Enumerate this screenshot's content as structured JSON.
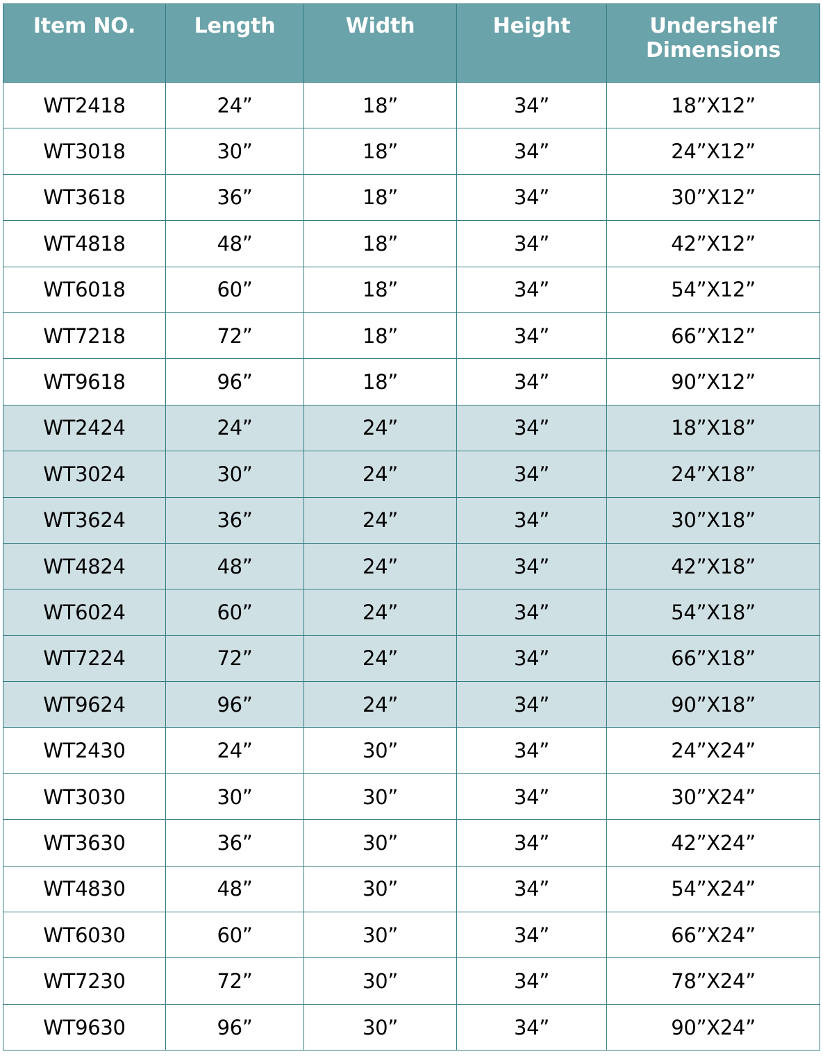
{
  "table": {
    "headers": [
      "Item NO.",
      "Length",
      "Width",
      "Height",
      "Undershelf Dimensions"
    ],
    "colors": {
      "header_background": "#6AA3A9",
      "header_text": "#FFFFFF",
      "border": "#2F7B82",
      "shaded_row_background": "#CFE0E4",
      "plain_row_background": "#FFFFFF",
      "cell_text": "#000000"
    },
    "rows": [
      {
        "item_no": "WT2418",
        "length": "24”",
        "width": "18”",
        "height": "34”",
        "undershelf": "18”X12”",
        "shaded": false
      },
      {
        "item_no": "WT3018",
        "length": "30”",
        "width": "18”",
        "height": "34”",
        "undershelf": "24”X12”",
        "shaded": false
      },
      {
        "item_no": "WT3618",
        "length": "36”",
        "width": "18”",
        "height": "34”",
        "undershelf": "30”X12”",
        "shaded": false
      },
      {
        "item_no": "WT4818",
        "length": "48”",
        "width": "18”",
        "height": "34”",
        "undershelf": "42”X12”",
        "shaded": false
      },
      {
        "item_no": "WT6018",
        "length": "60”",
        "width": "18”",
        "height": "34”",
        "undershelf": "54”X12”",
        "shaded": false
      },
      {
        "item_no": "WT7218",
        "length": "72”",
        "width": "18”",
        "height": "34”",
        "undershelf": "66”X12”",
        "shaded": false
      },
      {
        "item_no": "WT9618",
        "length": "96”",
        "width": "18”",
        "height": "34”",
        "undershelf": "90”X12”",
        "shaded": false
      },
      {
        "item_no": "WT2424",
        "length": "24”",
        "width": "24”",
        "height": "34”",
        "undershelf": "18”X18”",
        "shaded": true
      },
      {
        "item_no": "WT3024",
        "length": "30”",
        "width": "24”",
        "height": "34”",
        "undershelf": "24”X18”",
        "shaded": true
      },
      {
        "item_no": "WT3624",
        "length": "36”",
        "width": "24”",
        "height": "34”",
        "undershelf": "30”X18”",
        "shaded": true
      },
      {
        "item_no": "WT4824",
        "length": "48”",
        "width": "24”",
        "height": "34”",
        "undershelf": "42”X18”",
        "shaded": true
      },
      {
        "item_no": "WT6024",
        "length": "60”",
        "width": "24”",
        "height": "34”",
        "undershelf": "54”X18”",
        "shaded": true
      },
      {
        "item_no": "WT7224",
        "length": "72”",
        "width": "24”",
        "height": "34”",
        "undershelf": "66”X18”",
        "shaded": true
      },
      {
        "item_no": "WT9624",
        "length": "96”",
        "width": "24”",
        "height": "34”",
        "undershelf": "90”X18”",
        "shaded": true
      },
      {
        "item_no": "WT2430",
        "length": "24”",
        "width": "30”",
        "height": "34”",
        "undershelf": "24”X24”",
        "shaded": false
      },
      {
        "item_no": "WT3030",
        "length": "30”",
        "width": "30”",
        "height": "34”",
        "undershelf": "30”X24”",
        "shaded": false
      },
      {
        "item_no": "WT3630",
        "length": "36”",
        "width": "30”",
        "height": "34”",
        "undershelf": "42”X24”",
        "shaded": false
      },
      {
        "item_no": "WT4830",
        "length": "48”",
        "width": "30”",
        "height": "34”",
        "undershelf": "54”X24”",
        "shaded": false
      },
      {
        "item_no": "WT6030",
        "length": "60”",
        "width": "30”",
        "height": "34”",
        "undershelf": "66”X24”",
        "shaded": false
      },
      {
        "item_no": "WT7230",
        "length": "72”",
        "width": "30”",
        "height": "34”",
        "undershelf": "78”X24”",
        "shaded": false
      },
      {
        "item_no": "WT9630",
        "length": "96”",
        "width": "30”",
        "height": "34”",
        "undershelf": "90”X24”",
        "shaded": false
      }
    ]
  }
}
